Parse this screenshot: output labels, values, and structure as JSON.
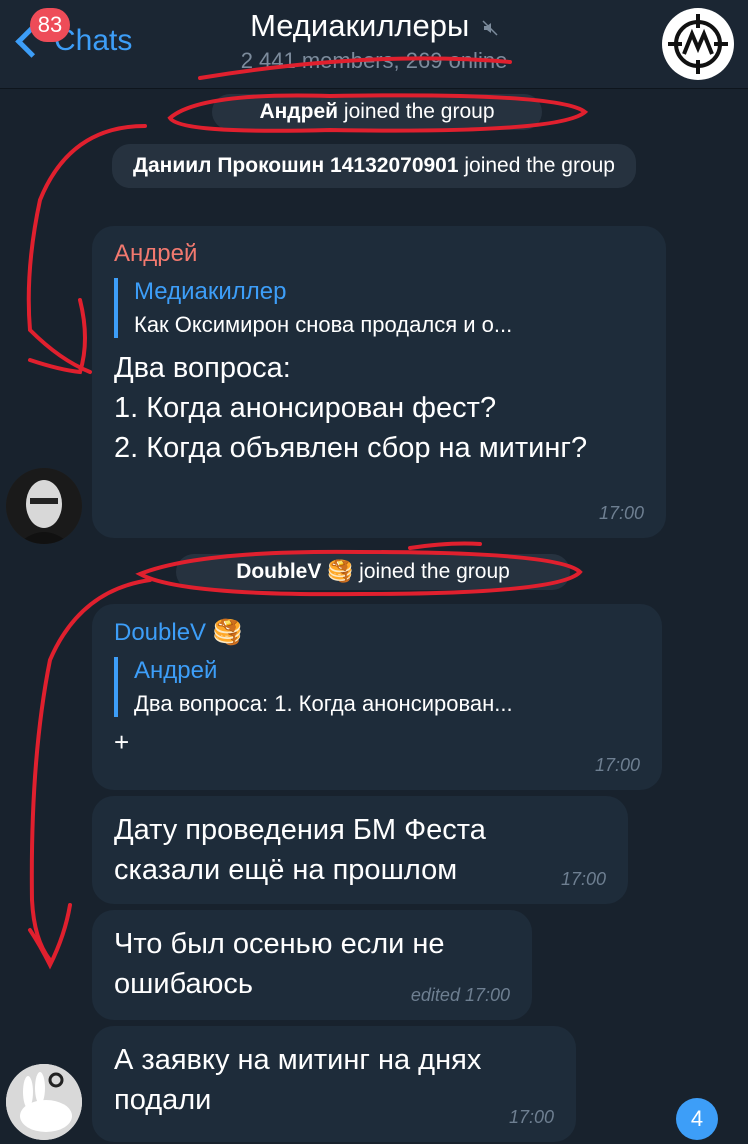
{
  "header": {
    "back_label": "Chats",
    "unread_count": "83",
    "title": "Медиакиллеры",
    "subtitle": "2 441 members, 269 online",
    "mute_icon": "speaker-mute-icon",
    "group_avatar_icon": "crosshair-m-logo-icon"
  },
  "service_messages": [
    {
      "name": "Андрей",
      "text": " joined the group"
    },
    {
      "name": "Даниил Прокошин 14132070901",
      "text": " joined the group"
    },
    {
      "name": "DoubleV 🥞",
      "text": " joined the group"
    }
  ],
  "messages": [
    {
      "sender": "Андрей",
      "sender_color": "#f2796f",
      "reply_name": "Медиакиллер",
      "reply_text": "Как Оксимирон снова продался и о...",
      "text": "Два вопроса:\n1. Когда анонсирован фест?\n2. Когда объявлен сбор на митинг?",
      "time": "17:00"
    },
    {
      "sender": "DoubleV 🥞",
      "sender_color": "#3d9ef8",
      "reply_name": "Андрей",
      "reply_text": "Два вопроса: 1. Когда анонсирован...",
      "text": "+",
      "time": "17:00"
    },
    {
      "text": "Дату проведения БМ Феста\nсказали ещё на прошлом",
      "time": "17:00"
    },
    {
      "text": "Что был осенью если не\nошибаюсь",
      "time": "edited 17:00"
    },
    {
      "text": "А заявку на митинг на днях\nподали",
      "time": "17:00"
    }
  ],
  "scroll_down_count": "4",
  "colors": {
    "background": "#18222d",
    "bubble": "#1e2c3a",
    "accent": "#3d9ef8",
    "annotation": "#e0202e"
  }
}
